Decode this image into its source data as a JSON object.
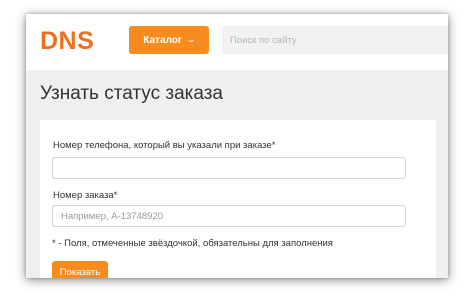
{
  "header": {
    "logo_text": "DNS",
    "catalog_label": "Каталог",
    "search_placeholder": "Поиск по сайту"
  },
  "main": {
    "title": "Узнать статус заказа",
    "form": {
      "phone_label": "Номер телефона, который вы указали при заказе*",
      "phone_value": "",
      "order_label": "Номер заказа*",
      "order_placeholder": "Например, А-13748920",
      "required_note": "* - Поля, отмеченные звёздочкой, обязательны для заполнения",
      "submit_label": "Показать"
    }
  },
  "colors": {
    "brand_orange": "#f68b1f",
    "logo_orange": "#f26f21",
    "page_background": "#efefef"
  },
  "icons": {
    "catalog_chevron": "chevron-down-icon"
  }
}
